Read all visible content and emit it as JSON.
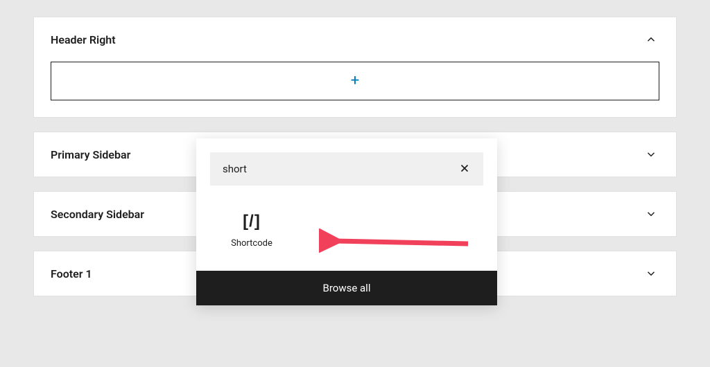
{
  "widget_areas": [
    {
      "title": "Header Right",
      "expanded": true
    },
    {
      "title": "Primary Sidebar",
      "expanded": false
    },
    {
      "title": "Secondary Sidebar",
      "expanded": false
    },
    {
      "title": "Footer 1",
      "expanded": false
    }
  ],
  "inserter": {
    "search_value": "short",
    "results": [
      {
        "icon": "[/]",
        "label": "Shortcode"
      }
    ],
    "browse_all_label": "Browse all"
  },
  "colors": {
    "accent": "#007cba",
    "annotation": "#f0405a"
  }
}
